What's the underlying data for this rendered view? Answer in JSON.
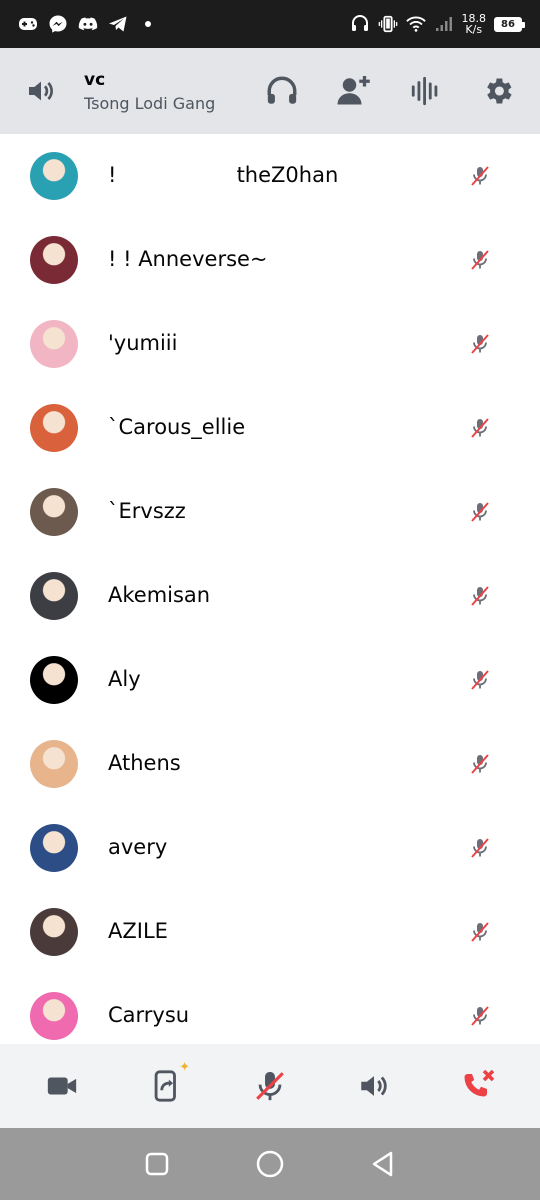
{
  "status_bar": {
    "left_icons": [
      "gamepad-icon",
      "messenger-icon",
      "discord-icon",
      "telegram-icon",
      "dot-icon"
    ],
    "net_speed_value": "18.8",
    "net_speed_unit": "K/s",
    "battery": "86"
  },
  "header": {
    "title": "vc",
    "subtitle": "Tsong Lodi Gang",
    "actions": [
      "headphones-icon",
      "add-friend-icon",
      "voice-activity-icon",
      "settings-icon"
    ]
  },
  "members": [
    {
      "name": "!                  theZ0han",
      "avatar_color": "#2aa1b3"
    },
    {
      "name": "! ! Anneverse~",
      "avatar_color": "#7a2a35"
    },
    {
      "name": "'yumiii",
      "avatar_color": "#f2b5c4"
    },
    {
      "name": "`Carous_ellie",
      "avatar_color": "#d9613b"
    },
    {
      "name": "`Ervszz",
      "avatar_color": "#6b5a4d"
    },
    {
      "name": "Akemisan",
      "avatar_color": "#3d3d44"
    },
    {
      "name": "Aly",
      "avatar_color": "#000000"
    },
    {
      "name": "Athens",
      "avatar_color": "#e8b48c"
    },
    {
      "name": "avery",
      "avatar_color": "#2d4d86"
    },
    {
      "name": "AZILE",
      "avatar_color": "#4a3a3a"
    },
    {
      "name": "Carrysu",
      "avatar_color": "#f06ab0"
    }
  ],
  "bottom_bar": {
    "buttons": [
      "camera-icon",
      "screen-share-icon",
      "mute-mic-icon",
      "speaker-icon",
      "leave-call-icon"
    ]
  },
  "colors": {
    "header_bg": "#e3e5e8",
    "icon_gray": "#4f5660",
    "danger_red": "#ed4245",
    "bottom_bg": "#f2f3f5"
  }
}
